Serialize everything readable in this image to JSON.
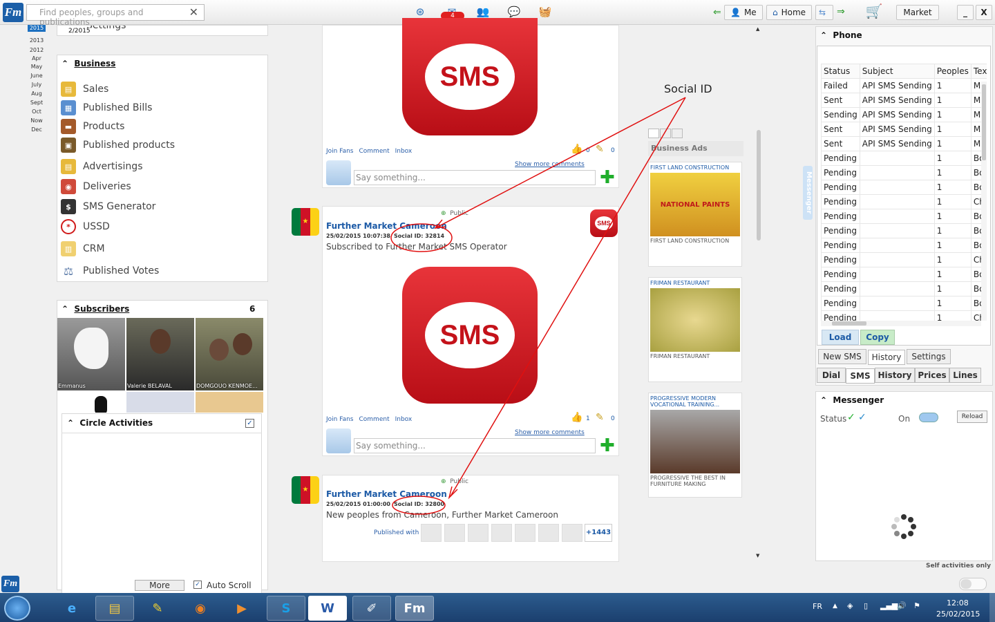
{
  "search": {
    "placeholder": "Find peoples, groups and publications"
  },
  "header": {
    "notif_count": "4",
    "me_label": "Me",
    "home_label": "Home",
    "market_label": "Market"
  },
  "left": {
    "settings_label": "Settings",
    "date_label": "2/2015",
    "years": [
      "2015",
      "2013",
      "2012"
    ],
    "months": [
      "Apr",
      "May",
      "June",
      "July",
      "Aug",
      "Sept",
      "Oct",
      "Now",
      "Dec"
    ],
    "business": {
      "title": "Business",
      "items": [
        "Sales",
        "Published Bills",
        "Products",
        "Published products",
        "Advertisings",
        "Deliveries",
        "SMS Generator",
        "USSD",
        "CRM",
        "Published Votes"
      ]
    },
    "subscribers": {
      "title": "Subscribers",
      "count": "6",
      "names": [
        "Emmanus",
        "Valerie BELAVAL",
        "DOMGOUO KENMOE..."
      ]
    },
    "circle": {
      "title": "Circle Activities",
      "more": "More",
      "autoscroll": "Auto Scroll"
    }
  },
  "feed": {
    "sms_text": "SMS",
    "links": [
      "Join Fans",
      "Comment",
      "Inbox"
    ],
    "show_more": "Show more comments",
    "comment_placeholder": "Say something...",
    "post1": {
      "likes": "0",
      "notes": "0"
    },
    "post2": {
      "visibility": "Public",
      "name": "Further Market Cameroon",
      "date": "25/02/2015 10:07:38",
      "social_id": "Social ID: 32814",
      "text": "Subscribed to Further Market SMS Operator",
      "likes": "1",
      "notes": "0"
    },
    "post3": {
      "visibility": "Public",
      "name": "Further Market Cameroon",
      "date": "25/02/2015 01:00:00",
      "social_id": "Social ID: 32800",
      "text": "New peoples from Cameroon, Further Market Cameroon",
      "published_with": "Published with",
      "extra_count": "+1443"
    }
  },
  "ads": {
    "annotation": "Social ID",
    "title": "Business Ads",
    "items": [
      {
        "title": "FIRST LAND CONSTRUCTION",
        "caption": "FIRST LAND CONSTRUCTION"
      },
      {
        "title": "FRIMAN RESTAURANT",
        "caption": "FRIMAN RESTAURANT"
      },
      {
        "title": "PROGRESSIVE MODERN VOCATIONAL TRAINING...",
        "caption": "PROGRESSIVE THE BEST IN FURNITURE MAKING"
      }
    ],
    "paint_label": "NATIONAL PAINTS",
    "messenger_tab": "Messenger"
  },
  "phone": {
    "title": "Phone",
    "columns": [
      "Status",
      "Subject",
      "Peoples",
      "Text"
    ],
    "rows": [
      [
        "Failed",
        "API SMS Sending",
        "1",
        "MINI"
      ],
      [
        "Sent",
        "API SMS Sending",
        "1",
        "MINI"
      ],
      [
        "Sending",
        "API SMS Sending",
        "1",
        "MINI"
      ],
      [
        "Sent",
        "API SMS Sending",
        "1",
        "MINI"
      ],
      [
        "Sent",
        "API SMS Sending",
        "1",
        "MINI"
      ],
      [
        "Pending",
        "",
        "1",
        "Bonjo"
      ],
      [
        "Pending",
        "",
        "1",
        "Bonjo"
      ],
      [
        "Pending",
        "",
        "1",
        "Bonjo"
      ],
      [
        "Pending",
        "",
        "1",
        "Cher"
      ],
      [
        "Pending",
        "",
        "1",
        "Bonjo"
      ],
      [
        "Pending",
        "",
        "1",
        "Bonjo"
      ],
      [
        "Pending",
        "",
        "1",
        "Bonjo"
      ],
      [
        "Pending",
        "",
        "1",
        "Cher"
      ],
      [
        "Pending",
        "",
        "1",
        "Bonjo"
      ],
      [
        "Pending",
        "",
        "1",
        "Bonjo"
      ],
      [
        "Pending",
        "",
        "1",
        "Bonjo"
      ],
      [
        "Pending",
        "",
        "1",
        "Cher"
      ]
    ],
    "load": "Load",
    "copy": "Copy",
    "tabs1": [
      "New SMS",
      "History",
      "Settings"
    ],
    "tabs2": [
      "Dial",
      "SMS",
      "History",
      "Prices",
      "Lines"
    ]
  },
  "messenger": {
    "title": "Messenger",
    "status_label": "Status",
    "on_label": "On",
    "reload": "Reload",
    "self_only": "Self activities only"
  },
  "taskbar": {
    "lang": "FR",
    "time": "12:08",
    "date": "25/02/2015"
  }
}
